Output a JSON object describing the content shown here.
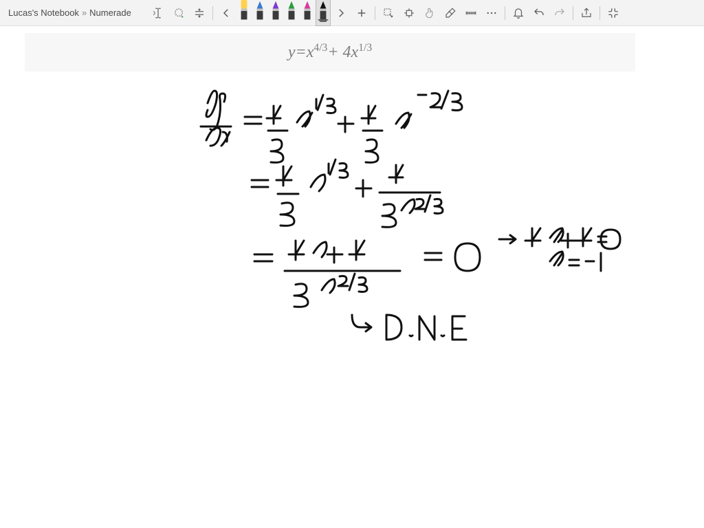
{
  "breadcrumb": {
    "notebook": "Lucas's Notebook",
    "separator": "»",
    "page": "Numerade"
  },
  "toolbar": {
    "text_tool": "text-tool",
    "lasso": "lasso-select",
    "insert_space": "insert-space",
    "prev": "previous-pen",
    "next": "next-pen",
    "add_pen": "add-pen",
    "select": "selection-tool",
    "pan": "pan-tool",
    "draw_touch": "draw-with-touch",
    "eraser": "eraser",
    "ruler": "ruler",
    "more": "more",
    "notifications": "notifications",
    "undo": "undo",
    "redo": "redo",
    "share": "share",
    "fullscreen": "exit-fullscreen"
  },
  "pens": [
    {
      "type": "highlighter",
      "color": "#ffd24a"
    },
    {
      "type": "pen",
      "color": "#3a7ad1"
    },
    {
      "type": "pen",
      "color": "#7a3bd1"
    },
    {
      "type": "pen",
      "color": "#2c9c3b"
    },
    {
      "type": "pen",
      "color": "#d63a9c"
    },
    {
      "type": "pen",
      "color": "#111111",
      "selected": true
    }
  ],
  "formula": {
    "display": "y = x^{4/3} + 4x^{1/3}",
    "y": "y",
    "eq": " = ",
    "x1": "x",
    "sup1": "4/3",
    "plus": " + 4",
    "x2": "x",
    "sup2": "1/3"
  },
  "handwriting": {
    "line1": "dy/dx = 4/3 x^{1/3} + 4/3 x^{-2/3}",
    "line2": "= 4/3 x^{1/3} + 4 / (3 x^{2/3})",
    "line3": "= (4x + 4) / (3 x^{2/3}) = 0",
    "arrow": "→ 4x + 4 = 0   x = -1",
    "dne": "↳ D.N.E"
  }
}
